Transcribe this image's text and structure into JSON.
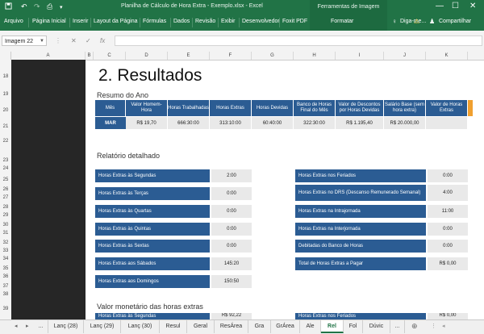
{
  "titlebar": {
    "title": "Planilha de Cálculo de Hora Extra - Exemplo.xlsx - Excel",
    "context_tab": "Ferramentas de Imagem",
    "save_icon": "save-icon",
    "undo_icon": "undo-icon",
    "redo_icon": "redo-icon",
    "preview_icon": "print-preview-icon",
    "customize_icon": "customize-quick-access-icon"
  },
  "ribbon": {
    "tabs": [
      "Arquivo",
      "Página Inicial",
      "Inserir",
      "Layout da Página",
      "Fórmulas",
      "Dados",
      "Revisão",
      "Exibir",
      "Desenvolvedor",
      "Foxit PDF"
    ],
    "context_tab": "Formatar",
    "tell_me": "Diga-me...",
    "share": "Compartilhar"
  },
  "formula_bar": {
    "name_box": "Imagem 22",
    "cancel": "✕",
    "enter": "✓",
    "fx": "fx",
    "value": ""
  },
  "columns": [
    "A",
    "B",
    "C",
    "D",
    "E",
    "F",
    "G",
    "H",
    "I",
    "J",
    "K"
  ],
  "rows": [
    "18",
    "19",
    "20",
    "21",
    "22",
    "23",
    "24",
    "25",
    "26",
    "27",
    "28",
    "29",
    "30",
    "31",
    "32",
    "33",
    "34",
    "35",
    "36",
    "37",
    "38",
    "39"
  ],
  "sheet": {
    "heading": "2. Resultados",
    "summary_title": "Resumo do Ano",
    "summary_headers": [
      "Mês",
      "Valor Homem-Hora",
      "Horas Trabalhadas",
      "Horas Extras",
      "Horas Devidas",
      "Banco de Horas Final do Mês",
      "Valor de Descontos por Horas Devidas",
      "Salário Base (sem hora extra)",
      "Valor de Horas Extras"
    ],
    "summary_row": [
      "MAR",
      "R$ 19,70",
      "666:30:00",
      "313:10:00",
      "60:40:00",
      "322:30:00",
      "R$ 1.195,40",
      "R$ 20.000,00",
      ""
    ],
    "detail_title": "Relatório detalhado",
    "detail_left": [
      {
        "label": "Horas Extras às Segundas",
        "value": "2:00"
      },
      {
        "label": "Horas Extras às Terças",
        "value": "0:00"
      },
      {
        "label": "Horas Extras às Quartas",
        "value": "0:00"
      },
      {
        "label": "Horas Extras às Quintas",
        "value": "0:00"
      },
      {
        "label": "Horas Extras às Sextas",
        "value": "0:00"
      },
      {
        "label": "Horas Extras aos Sábados",
        "value": "145:20"
      },
      {
        "label": "Horas Extras aos Domingos",
        "value": "150:50"
      }
    ],
    "detail_right": [
      {
        "label": "Horas Extras nos Feriados",
        "value": "0:00"
      },
      {
        "label": "Horas Extras no DRS (Descanso Remunerado Semanal)",
        "value": "4:00"
      },
      {
        "label": "Horas Extras na Intrajornada",
        "value": "11:00"
      },
      {
        "label": "Horas Extras na Interjornada",
        "value": "0:00"
      },
      {
        "label": "Debitadas do Banco de Horas",
        "value": "0:00"
      },
      {
        "label": "Total de Horas Extras a Pagar",
        "value": "R$ 0,00"
      }
    ],
    "monetary_title": "Valor monetário das horas extras",
    "monetary_left": {
      "label": "Horas Extras às Segundas",
      "value": "R$ 92,22"
    },
    "monetary_right": {
      "label": "Horas Extras nos Feriados",
      "value": "R$ 0,00"
    }
  },
  "sheet_tabs": {
    "tabs": [
      "...",
      "Lanç (28)",
      "Lanç (29)",
      "Lanç (30)",
      "Resul",
      "Geral",
      "ResÁrea",
      "Gra",
      "GrÁrea",
      "Ale",
      "Rel",
      "Fol",
      "Dúvic",
      "..."
    ],
    "active": "Rel"
  },
  "colors": {
    "excel_green": "#217346",
    "header_blue": "#2b5c93",
    "cell_gray": "#e9e9e9",
    "dark_column": "#262626"
  }
}
